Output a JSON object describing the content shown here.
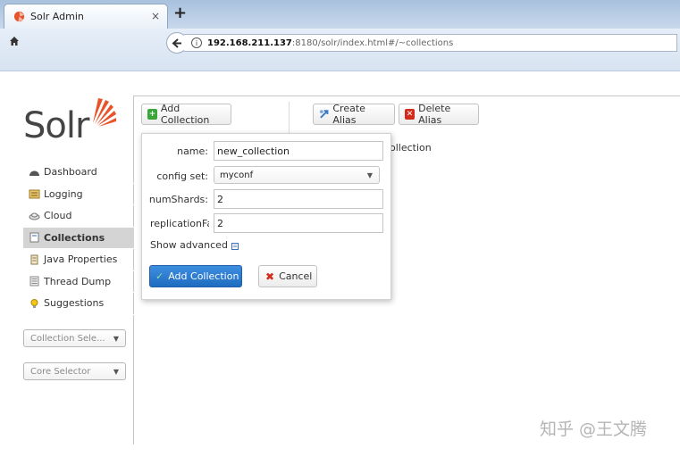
{
  "browser": {
    "tab_title": "Solr Admin",
    "tab_close": "×",
    "new_tab": "+",
    "url_host": "192.168.211.137",
    "url_rest": ":8180/solr/index.html#/~collections"
  },
  "logo": {
    "text": "Solr"
  },
  "sidebar": {
    "items": [
      {
        "label": "Dashboard",
        "icon": "dashboard-icon"
      },
      {
        "label": "Logging",
        "icon": "logging-icon"
      },
      {
        "label": "Cloud",
        "icon": "cloud-icon"
      },
      {
        "label": "Collections",
        "icon": "collections-icon",
        "active": true
      },
      {
        "label": "Java Properties",
        "icon": "java-properties-icon"
      },
      {
        "label": "Thread Dump",
        "icon": "thread-dump-icon"
      },
      {
        "label": "Suggestions",
        "icon": "suggestions-icon"
      }
    ],
    "collection_selector": "Collection Sele...",
    "core_selector": "Core Selector"
  },
  "toolbar": {
    "add_collection": "Add Collection",
    "create_alias": "Create Alias",
    "delete_alias": "Delete Alias"
  },
  "background_text": "ollection",
  "form": {
    "name_label": "name:",
    "name_value": "new_collection",
    "config_label": "config set:",
    "config_value": "myconf",
    "shards_label": "numShards:",
    "shards_value": "2",
    "replication_label": "replicationFactor:",
    "replication_value": "2",
    "show_advanced": "Show advanced",
    "submit": "Add Collection",
    "cancel": "Cancel"
  },
  "watermark": "知乎 @王文腾",
  "colors": {
    "primary_button": "#2a7bd0",
    "active_item_bg": "#d4d4d4",
    "cancel_icon": "#d42a1c",
    "add_icon": "#3aa63a",
    "delete_icon": "#d42a1c"
  }
}
